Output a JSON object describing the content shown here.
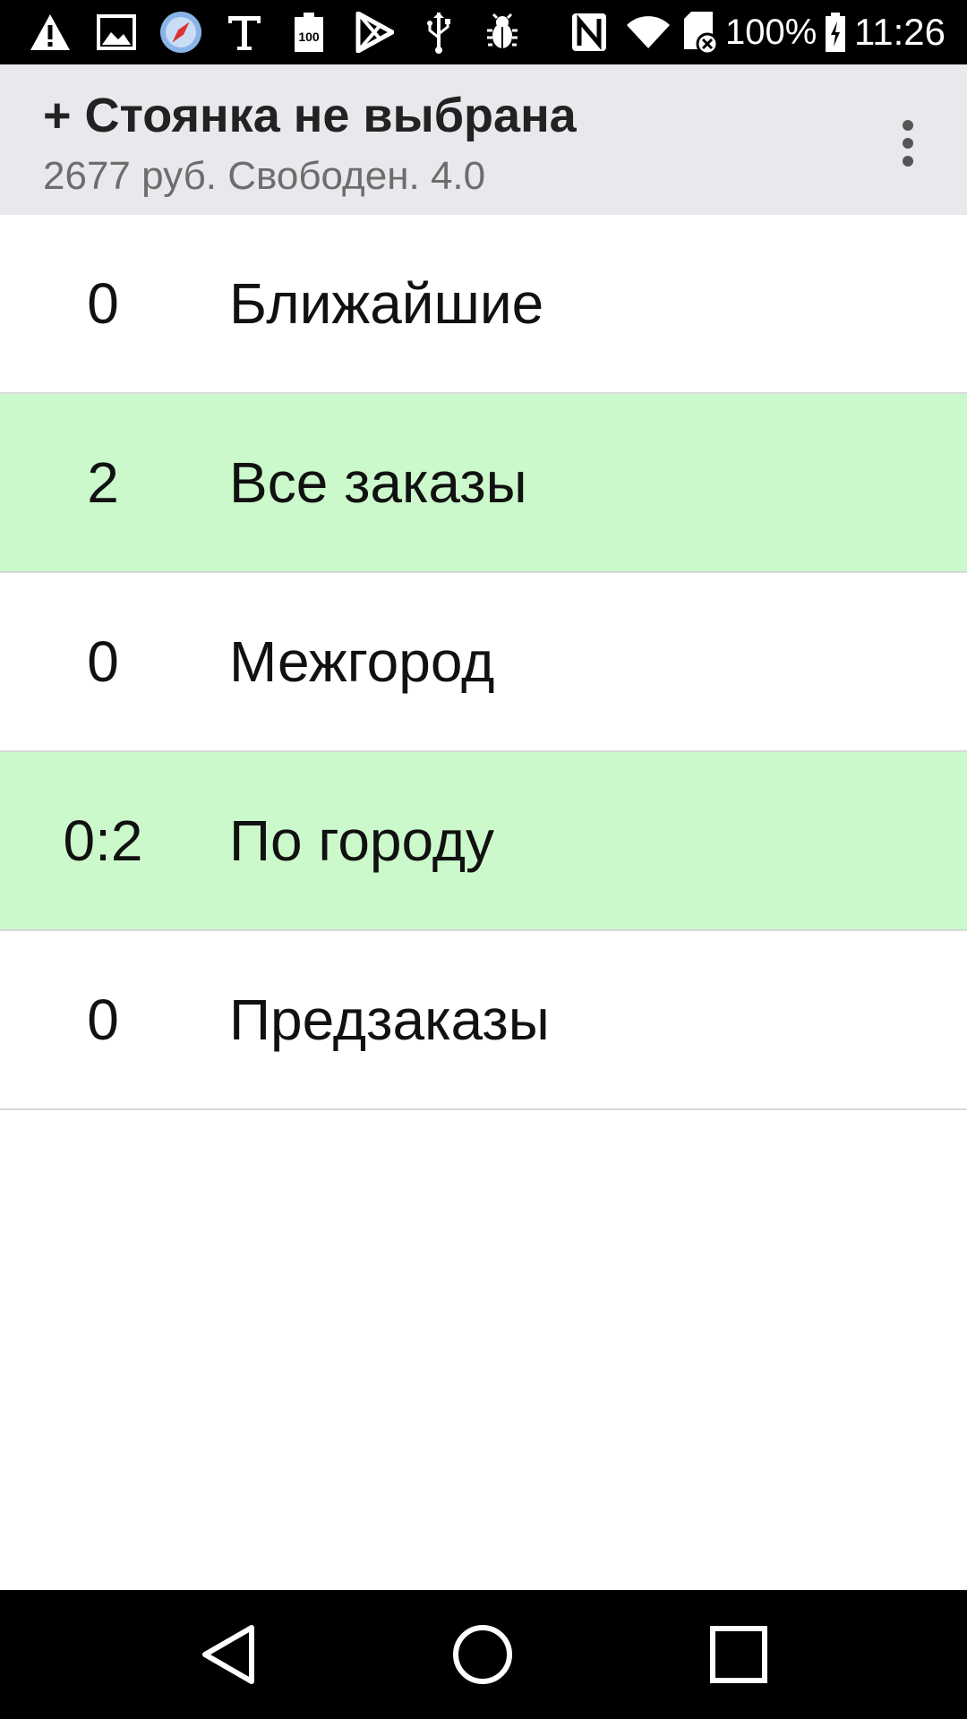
{
  "status_bar": {
    "left_icons": [
      "warning-icon",
      "image-icon",
      "compass-icon",
      "text-t-icon",
      "battery-100-icon",
      "play-store-icon",
      "usb-icon",
      "bug-icon"
    ],
    "right_icons": [
      "nfc-icon",
      "wifi-icon",
      "sd-card-icon"
    ],
    "battery_percent": "100%",
    "time": "11:26"
  },
  "app_bar": {
    "title": "+ Стоянка не выбрана",
    "subtitle": "2677 руб. Свободен. 4.0",
    "menu_icon": "more-vert-icon"
  },
  "list": {
    "items": [
      {
        "count": "0",
        "label": "Ближайшие",
        "highlight": false
      },
      {
        "count": "2",
        "label": "Все заказы",
        "highlight": true
      },
      {
        "count": "0",
        "label": "Межгород",
        "highlight": false
      },
      {
        "count": "0:2",
        "label": "По городу",
        "highlight": true
      },
      {
        "count": "0",
        "label": "Предзаказы",
        "highlight": false
      }
    ],
    "highlight_color": "#ccf9cc"
  },
  "nav_bar": {
    "buttons": [
      "back-icon",
      "home-icon",
      "recents-icon"
    ]
  }
}
